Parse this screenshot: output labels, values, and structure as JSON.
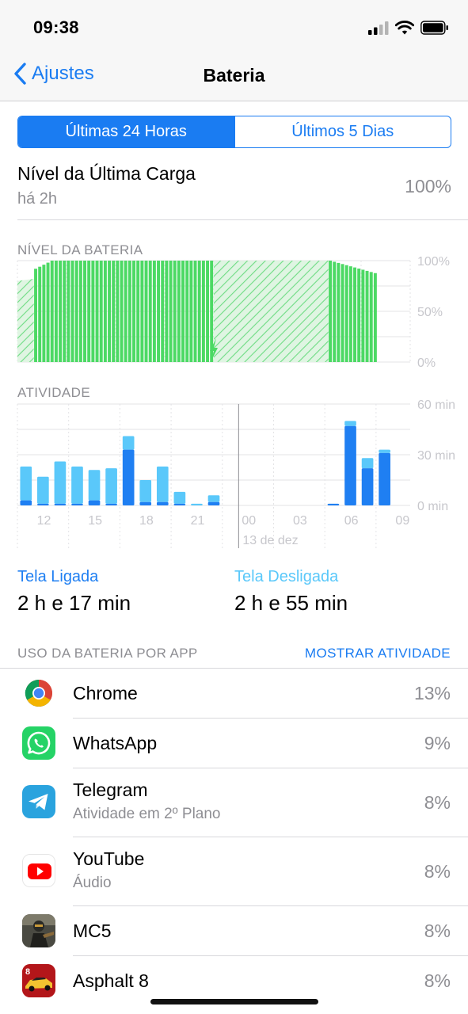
{
  "status_bar": {
    "time": "09:38"
  },
  "nav": {
    "back_label": "Ajustes",
    "title": "Bateria"
  },
  "segments": [
    {
      "label": "Últimas 24 Horas",
      "selected": true
    },
    {
      "label": "Últimos 5 Dias",
      "selected": false
    }
  ],
  "last_charge": {
    "title": "Nível da Última Carga",
    "time": "há 2h",
    "value": "100%"
  },
  "chart_data": [
    {
      "type": "bar",
      "title": "NÍVEL DA BATERIA",
      "y_tick_labels": [
        "100%",
        "50%",
        "0%"
      ],
      "ylim": [
        0,
        100
      ],
      "unit": "%",
      "colors": {
        "battery": "#4cd964",
        "charging_hatch": "#4cd964"
      },
      "segments": [
        {
          "hours_from_start": [
            0.0,
            1.0
          ],
          "level_start": 80,
          "level_end": 82,
          "charging": true
        },
        {
          "hours_from_start": [
            1.0,
            2.0
          ],
          "level_start": 92,
          "level_end": 100,
          "charging": false
        },
        {
          "hours_from_start": [
            2.0,
            12.0
          ],
          "level_start": 100,
          "level_end": 100,
          "charging": false
        },
        {
          "hours_from_start": [
            12.0,
            19.0
          ],
          "level_start": 100,
          "level_end": 100,
          "charging": true
        },
        {
          "hours_from_start": [
            19.0,
            21.9
          ],
          "level_start": 100,
          "level_end": 87,
          "charging": false
        }
      ],
      "charge_marker_hour": 12
    },
    {
      "type": "bar",
      "title": "ATIVIDADE",
      "categories": [
        "11",
        "12",
        "13",
        "14",
        "15",
        "16",
        "17",
        "18",
        "19",
        "20",
        "21",
        "22",
        "23",
        "00",
        "01",
        "02",
        "03",
        "04",
        "05",
        "06",
        "07",
        "08",
        "09"
      ],
      "x_tick_labels": [
        "12",
        "15",
        "18",
        "21",
        "00",
        "03",
        "06",
        "09"
      ],
      "date_label": "13 de dez",
      "y_tick_labels": [
        "60 min",
        "30 min",
        "0 min"
      ],
      "ylim": [
        0,
        60
      ],
      "unit": "min",
      "series": [
        {
          "name": "Tela Ligada",
          "color": "#1f7ff2",
          "values": [
            3,
            1,
            1,
            1,
            3,
            1,
            33,
            2,
            2,
            1,
            0,
            2,
            0,
            0,
            0,
            0,
            0,
            0,
            1,
            47,
            22,
            31,
            0
          ]
        },
        {
          "name": "Tela Desligada",
          "color": "#5ac8fa",
          "values": [
            20,
            16,
            25,
            22,
            18,
            21,
            8,
            13,
            21,
            7,
            1,
            4,
            0,
            0,
            0,
            0,
            0,
            0,
            0,
            3,
            6,
            2,
            0
          ]
        }
      ]
    }
  ],
  "screen_time": {
    "on": {
      "label": "Tela Ligada",
      "value": "2 h e 17 min",
      "color": "#1f7ff2"
    },
    "off": {
      "label": "Tela Desligada",
      "value": "2 h e 55 min",
      "color": "#5ac8fa"
    }
  },
  "usage": {
    "header": "USO DA BATERIA POR APP",
    "action": "MOSTRAR ATIVIDADE",
    "apps": [
      {
        "name": "Chrome",
        "sub": "",
        "pct": "13%",
        "icon": "chrome-icon"
      },
      {
        "name": "WhatsApp",
        "sub": "",
        "pct": "9%",
        "icon": "whatsapp-icon"
      },
      {
        "name": "Telegram",
        "sub": "Atividade em 2º Plano",
        "pct": "8%",
        "icon": "telegram-icon"
      },
      {
        "name": "YouTube",
        "sub": "Áudio",
        "pct": "8%",
        "icon": "youtube-icon"
      },
      {
        "name": "MC5",
        "sub": "",
        "pct": "8%",
        "icon": "mc5-icon"
      },
      {
        "name": "Asphalt 8",
        "sub": "",
        "pct": "8%",
        "icon": "asphalt-icon"
      }
    ]
  }
}
